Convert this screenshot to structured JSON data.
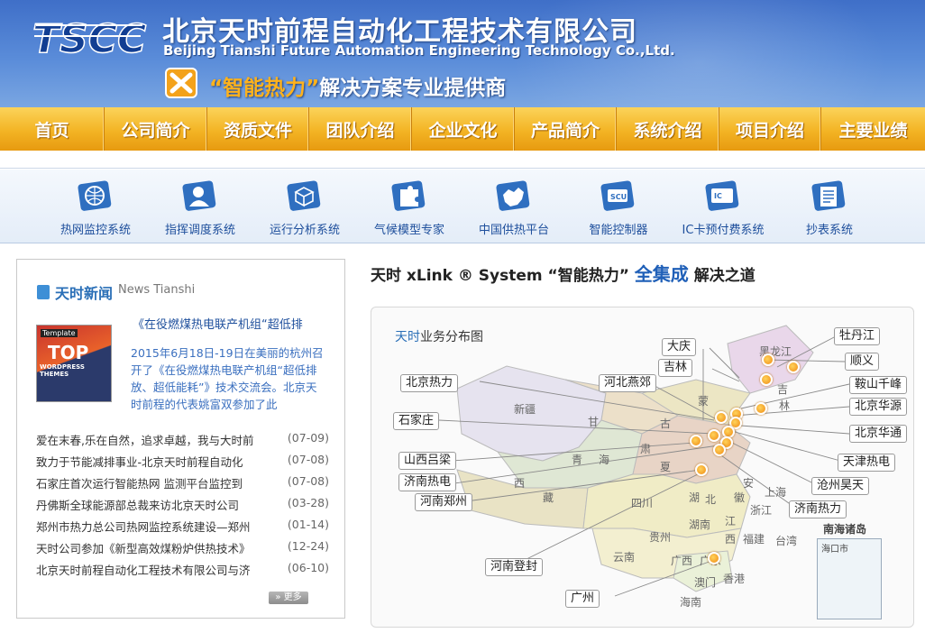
{
  "header": {
    "logo_text": "TSCC",
    "company_cn": "北京天时前程自动化工程技术有限公司",
    "company_en": "Beijing Tianshi Future Automation Engineering Technology Co.,Ltd.",
    "slogan_quote": "“智能热力”",
    "slogan_rest": "解决方案专业提供商"
  },
  "nav": [
    "首页",
    "公司简介",
    "资质文件",
    "团队介绍",
    "企业文化",
    "产品简介",
    "系统介绍",
    "项目介绍",
    "主要业绩"
  ],
  "systems": [
    "热网监控系统",
    "指挥调度系统",
    "运行分析系统",
    "气候模型专家",
    "中国供热平台",
    "智能控制器",
    "IC卡预付费系统",
    "抄表系统"
  ],
  "news": {
    "title": "天时新闻",
    "title_en": "News Tianshi",
    "featured_image_text": {
      "small": "Template",
      "big": "TOP",
      "sub": "WORDPRESS THEMES"
    },
    "featured_headline": "《在役燃煤热电联产机组“超低排",
    "featured_body": "2015年6月18日-19日在美丽的杭州召开了《在役燃煤热电联产机组“超低排放、超低能耗”》技术交流会。北京天时前程的代表姚富双参加了此",
    "items": [
      {
        "title": "爱在末春,乐在自然，追求卓越，我与大时前",
        "date": "(07-09)"
      },
      {
        "title": "致力于节能减排事业-北京天时前程自动化",
        "date": "(07-08)"
      },
      {
        "title": "石家庄首次运行智能热网 监测平台监控到",
        "date": "(07-08)"
      },
      {
        "title": "丹佛斯全球能源部总裁来访北京天时公司",
        "date": "(03-28)"
      },
      {
        "title": "郑州市热力总公司热网监控系统建设—郑州",
        "date": "(01-14)"
      },
      {
        "title": "天时公司参加《新型高效煤粉炉供热技术》",
        "date": "(12-24)"
      },
      {
        "title": "北京天时前程自动化工程技术有限公司与济",
        "date": "(06-10)"
      }
    ],
    "more_label": "更多"
  },
  "map_section": {
    "heading_pre": "天时 xLink ® System “智能热力”",
    "heading_hl": "全集成",
    "heading_post": "解决之道",
    "map_title_brand": "天时",
    "map_title_rest": "业务分布图",
    "provinces": [
      "黑龙江",
      "新疆",
      "甘",
      "吉",
      "蒙",
      "古",
      "林",
      "青",
      "海",
      "肃",
      "夏",
      "西",
      "藏",
      "四川",
      "湖",
      "北",
      "安",
      "徽",
      "浙江",
      "上海",
      "江",
      "西",
      "贵州",
      "湖南",
      "福建",
      "云南",
      "广西",
      "广东",
      "香港",
      "澳门",
      "海南",
      "台湾"
    ],
    "callouts": [
      "大庆",
      "牡丹江",
      "吉林",
      "顺义",
      "北京热力",
      "河北燕郊",
      "鞍山千峰",
      "北京华源",
      "石家庄",
      "北京华通",
      "山西吕梁",
      "天津热电",
      "济南热电",
      "沧州昊天",
      "河南郑州",
      "济南热力",
      "河南登封",
      "广州"
    ],
    "south_sea_title": "南海诸岛",
    "south_sea_city": "海口市"
  },
  "colors": {
    "nav_orange": "#f3b424",
    "header_blue": "#4a7dd0",
    "accent_blue": "#2060b8"
  }
}
